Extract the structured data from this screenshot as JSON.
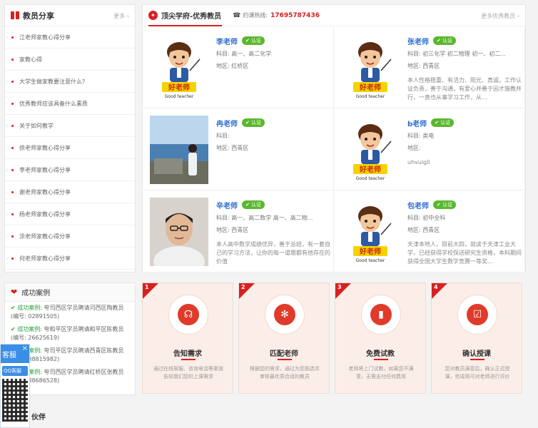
{
  "sidebar": {
    "title": "教员分享",
    "more": "更多 ›",
    "articles": [
      "江老师家教心得分享",
      "家教心得",
      "大学生做家教要注意什么?",
      "优秀教师应该具备什么素质",
      "关于如何教学",
      "徐老师家教心得分享",
      "李老师家教心得分享",
      "谢老师家教心得分享",
      "杨老师家教心得分享",
      "涂老师家教心得分享",
      "何老师家教心得分享"
    ]
  },
  "teachers_panel": {
    "title": "顶尖学府-优秀教员",
    "hotline_label": "约课热线:",
    "hotline": "17695787436",
    "more": "更多优秀教员 ›",
    "teachers": [
      {
        "name": "李老师",
        "badge": "认证",
        "subject": "科目: 高一、高二化学",
        "area": "地区: 红桥区",
        "intro": "",
        "photo": "cartoon"
      },
      {
        "name": "张老师",
        "badge": "认证",
        "subject": "科目: 初三化学 初二物理 初一、初二...",
        "area": "地区: 西青区",
        "intro": "本人性格稳重、有活力、阳光、真诚，工作认证负责，善于沟通，有爱心并善于因才施教并行，一直也从事学习工作，从...",
        "photo": "cartoon"
      },
      {
        "name": "冉老师",
        "badge": "认证",
        "subject": "科目:",
        "area": "地区: 西青区",
        "intro": "",
        "photo": "seaside"
      },
      {
        "name": "b老师",
        "badge": "认证",
        "subject": "科目: 类电",
        "area": "地区:",
        "intro": "uhvuigli",
        "photo": "cartoon"
      },
      {
        "name": "辛老师",
        "badge": "认证",
        "subject": "科目: 高一、高二数学 高一、高二物...",
        "area": "地区: 西青区",
        "intro": "本人高中数学成绩优异，善于总结，有一套自己的学习方法，让你的每一道题都有他存在的价值",
        "photo": "man"
      },
      {
        "name": "包老师",
        "badge": "认证",
        "subject": "科目: 初中全科",
        "area": "地区: 西青区",
        "intro": "天津本地人，目前大四，就读于天津工业大学，已经获得学校保送研究生资格，本科期间获得全国大学生数学竞赛一等奖...",
        "photo": "cartoon"
      }
    ],
    "cartoon_caption": "好老师",
    "cartoon_sub": "Good teacher"
  },
  "cases": {
    "title": "成功案例",
    "items": [
      {
        "tag": "成功案例:",
        "text": "夸司西区学员聘请河西区陶教员(编号: 02891505)"
      },
      {
        "tag": "成功案例:",
        "text": "夸和平区学员聘请和平区陈教员(编号: 26625619)"
      },
      {
        "tag": "成功案例:",
        "text": "夸司平区学员聘请西青区陈教员(编号: 88815982)"
      },
      {
        "tag": "成功案例:",
        "text": "夸司西区学员聘请红桥区张教员(编号: 88686528)"
      }
    ]
  },
  "steps": [
    {
      "num": "1",
      "title": "告知需求",
      "desc": "通过在线客服、咨询电话等渠道告知我们您的上课需求",
      "icon": "headset"
    },
    {
      "num": "2",
      "title": "匹配老师",
      "desc": "根据您的需求，通过为您挑选并审核最优质合适的教员",
      "icon": "network"
    },
    {
      "num": "3",
      "title": "免费试教",
      "desc": "老师将上门试教，如果您不满意，无需支付任何费用",
      "icon": "door"
    },
    {
      "num": "4",
      "title": "确认授课",
      "desc": "您对教员满意后，确认正式授课，完成简可对老师进行评价",
      "icon": "check-board"
    }
  ],
  "float": {
    "title": "客服",
    "qq": "QQ客服",
    "close": "×"
  },
  "bottom_label": "伙伴"
}
